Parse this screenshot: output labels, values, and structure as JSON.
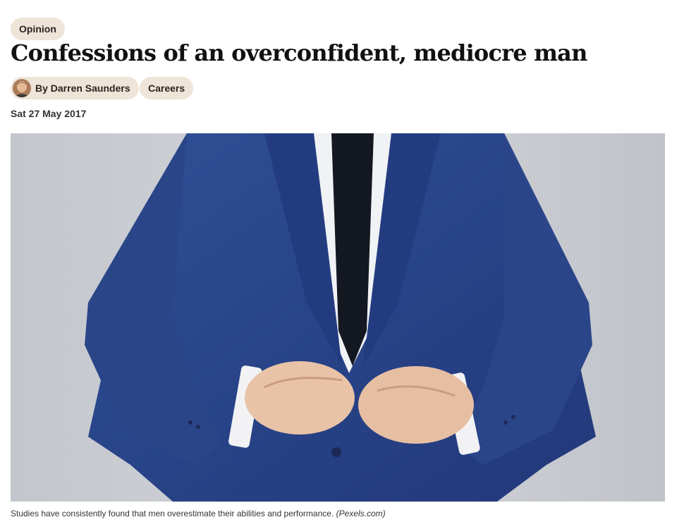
{
  "article": {
    "category": "Opinion",
    "headline": "Confessions of an overconfident, mediocre man",
    "author": "By Darren Saunders",
    "topic": "Careers",
    "date": "Sat 27 May 2017"
  },
  "hero_image": {
    "caption": "Studies have consistently found that men overestimate their abilities and performance.",
    "credit": "(Pexels.com)"
  },
  "colors": {
    "pill_background": "#efe4d8",
    "suit": "#2c4a8f",
    "backdrop": "#c9ccd2"
  }
}
